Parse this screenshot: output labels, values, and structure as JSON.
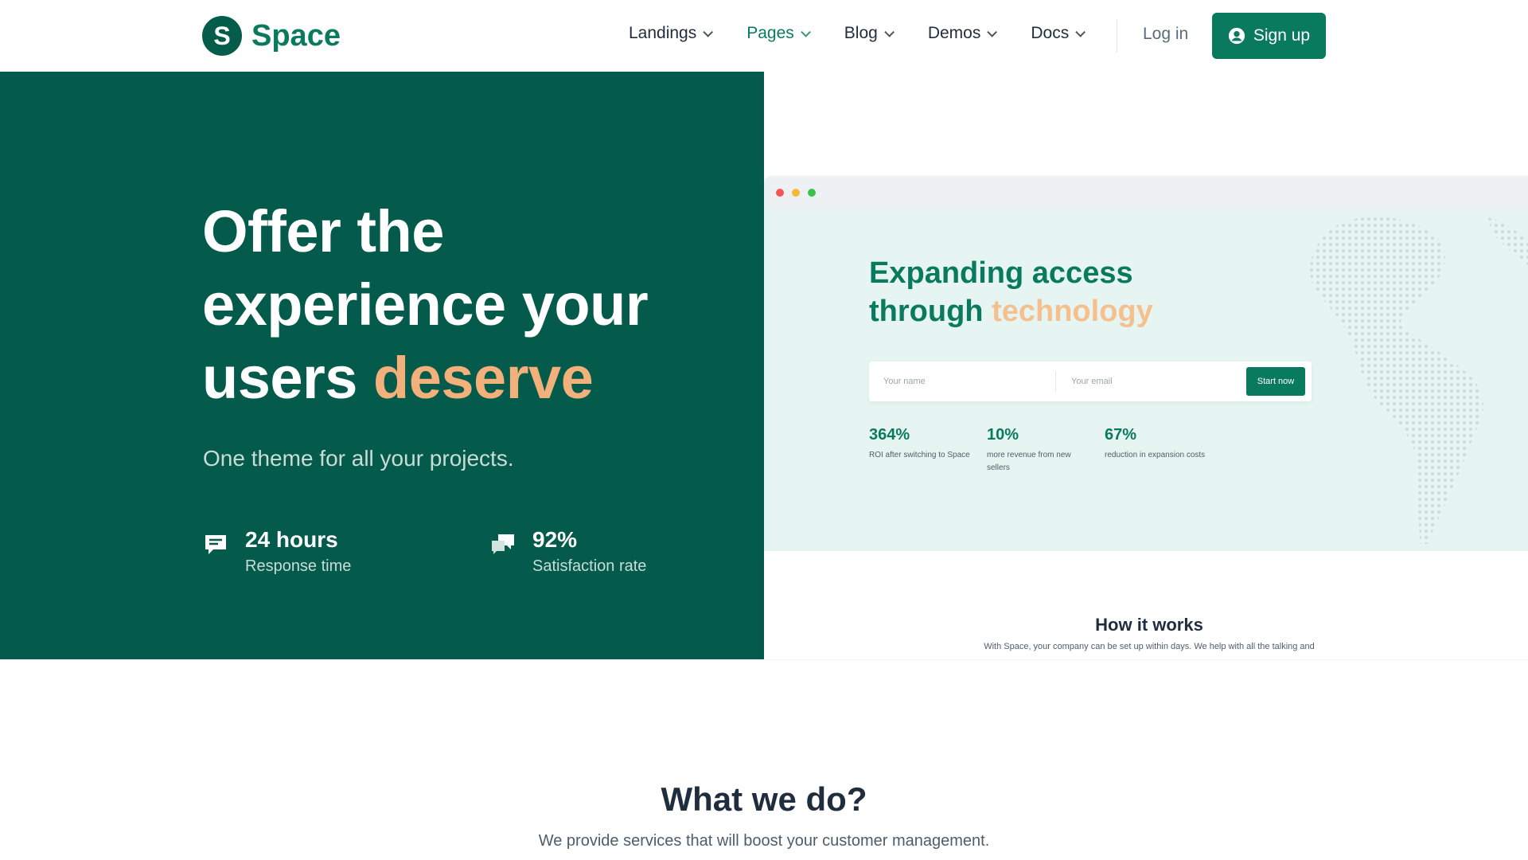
{
  "brand": {
    "logo_letter": "S",
    "name": "Space"
  },
  "nav": {
    "items": [
      {
        "label": "Landings"
      },
      {
        "label": "Pages"
      },
      {
        "label": "Blog"
      },
      {
        "label": "Demos"
      },
      {
        "label": "Docs"
      }
    ],
    "active_item": "Pages",
    "login_label": "Log in",
    "signup_label": "Sign up"
  },
  "hero": {
    "title_part1": "Offer the experience your users",
    "title_accent": "deserve",
    "subtitle": "One theme for all your projects.",
    "stats": [
      {
        "value": "24 hours",
        "label": "Response time",
        "icon": "chat-icon"
      },
      {
        "value": "92%",
        "label": "Satisfaction rate",
        "icon": "chat-bubbles-icon"
      }
    ]
  },
  "mockup": {
    "title_line1": "Expanding access",
    "title_line2_prefix": "through",
    "title_accent": "technology",
    "name_placeholder": "Your name",
    "email_placeholder": "Your email",
    "cta_label": "Start now",
    "stats": [
      {
        "value": "364%",
        "label": "ROI after switching to Space"
      },
      {
        "value": "10%",
        "label": "more revenue from new sellers"
      },
      {
        "value": "67%",
        "label": "reduction in expansion costs"
      }
    ],
    "how_title": "How it works",
    "how_text": "With Space, your company can be set up within days. We help with all the talking and"
  },
  "what": {
    "title": "What we do?",
    "subtitle": "We provide services that will boost your customer management."
  },
  "colors": {
    "primary": "#0a7a5f",
    "hero_bg": "#045a4b",
    "accent": "#f2b07a",
    "mockup_bg": "#e6f5f1"
  }
}
